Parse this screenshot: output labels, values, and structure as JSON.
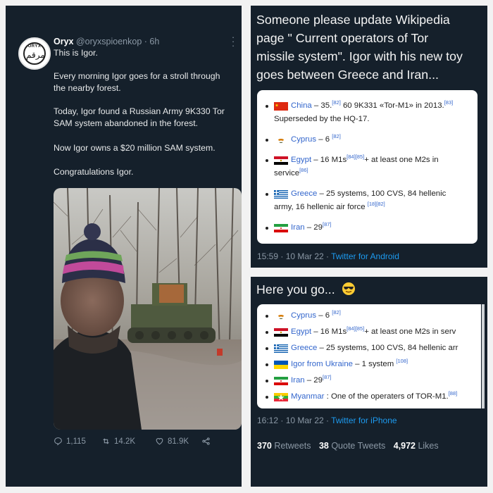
{
  "tweet1": {
    "name": "Oryx",
    "handle": "@oryxspioenkop",
    "time": "· 6h",
    "avatar_text": "ORYX",
    "lines": [
      "This is Igor.",
      "Every morning Igor goes for a stroll through",
      "the nearby forest.",
      "Today, Igor found a Russian Army 9K330 Tor",
      "SAM system abandoned in the forest.",
      "Now Igor owns a $20 million SAM system.",
      "Congratulations Igor."
    ],
    "replies": "1,115",
    "retweets": "14.2K",
    "likes": "81.9K",
    "icons": [
      "reply-icon",
      "retweet-icon",
      "like-icon",
      "share-icon"
    ]
  },
  "tweet2": {
    "text_lines": [
      "Someone please update Wikipedia",
      "page \" Current operators of Tor",
      "missile system\". Igor with his new toy",
      "goes between Greece and Iran..."
    ],
    "wiki": {
      "china": {
        "country": "China",
        "text": " – 35.",
        "ref1": "[82]",
        "text2": " 60 9K331 «Tor-M1» in 2013.",
        "ref2": "[83]",
        "line2": "Superseded by the HQ-17."
      },
      "cyprus": {
        "country": "Cyprus",
        "text": " – 6 ",
        "ref": "[82]"
      },
      "egypt": {
        "country": "Egypt",
        "text": " – 16 M1s",
        "ref1": "[84]",
        "ref2": "[85]",
        "text2": "+ at least one M2s in",
        "line2": "service",
        "ref3": "[86]"
      },
      "greece": {
        "country": "Greece",
        "text": " – 25 systems, 100 CVS, 84 hellenic",
        "line2": "army, 16 hellenic air force ",
        "ref1": "[18]",
        "ref2": "[82]"
      },
      "iran": {
        "country": "Iran",
        "text": " – 29",
        "ref": "[87]"
      }
    },
    "time": "15:59 · 10 Mar 22 · ",
    "client": "Twitter for Android"
  },
  "tweet3": {
    "text": "Here you go...",
    "wiki": {
      "cyprus": {
        "country": "Cyprus",
        "text": " – 6 ",
        "ref": "[82]"
      },
      "egypt": {
        "country": "Egypt",
        "text": " – 16 M1s",
        "ref1": "[84]",
        "ref2": "[85]",
        "text2": "+ at least one M2s in serv"
      },
      "greece": {
        "country": "Greece",
        "text": " – 25 systems, 100 CVS, 84 hellenic arr"
      },
      "ukraine": {
        "country": "Igor from Ukraine",
        "text": " – 1 system ",
        "ref": "[108]"
      },
      "iran": {
        "country": "Iran",
        "text": " – 29",
        "ref": "[87]"
      },
      "myanmar": {
        "country": "Myanmar",
        "text": " : One of the operaters of TOR-M1.",
        "ref": "[88]"
      }
    },
    "time": "16:12 · 10 Mar 22 · ",
    "client": "Twitter for iPhone",
    "retweets_count": "370",
    "retweets_label": " Retweets",
    "quotes_count": "38",
    "quotes_label": " Quote Tweets",
    "likes_count": "4,972",
    "likes_label": " Likes"
  },
  "colors": {
    "bg": "#15202b",
    "link": "#3366cc",
    "twitter_blue": "#1d9bf0",
    "muted": "#8b98a5"
  }
}
